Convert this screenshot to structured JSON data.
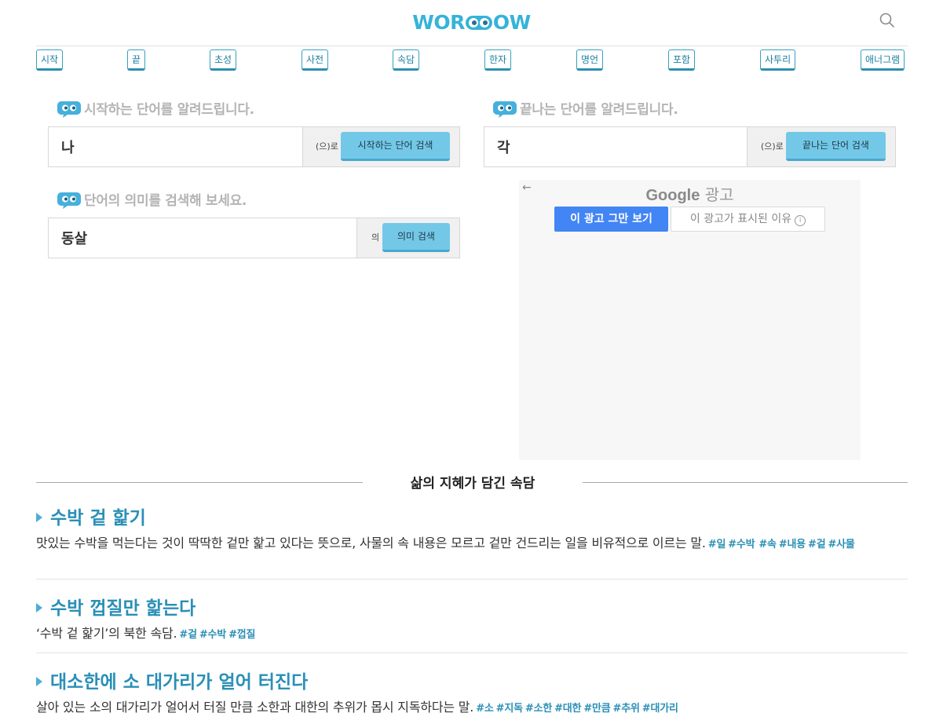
{
  "header": {
    "logo_text_left": "WOR",
    "logo_text_right": "OW",
    "nav": [
      "시작",
      "끝",
      "초성",
      "사전",
      "속담",
      "한자",
      "명언",
      "포함",
      "사투리",
      "애너그램"
    ]
  },
  "start_search": {
    "title": "시작하는 단어를 알려드립니다.",
    "value": "나",
    "suffix": "(으)로",
    "button": "시작하는 단어 검색"
  },
  "end_search": {
    "title": "끝나는 단어를 알려드립니다.",
    "value": "각",
    "suffix": "(으)로",
    "button": "끝나는 단어 검색"
  },
  "meaning_search": {
    "title": "단어의 의미를 검색해 보세요.",
    "value": "동살",
    "suffix": "의",
    "button": "의미 검색"
  },
  "ad": {
    "back": "←",
    "brand": "Google",
    "label": "광고",
    "stop_button": "이 광고 그만 보기",
    "why_button": "이 광고가 표시된 이유",
    "info_glyph": "i"
  },
  "proverbs_section": {
    "title": "삶의 지혜가 담긴 속담",
    "items": [
      {
        "title": "수박 겉 핥기",
        "desc": "맛있는 수박을 먹는다는 것이 딱딱한 겉만 핥고 있다는 뜻으로, 사물의 속 내용은 모르고 겉만 건드리는 일을 비유적으로 이르는 말.",
        "tags": [
          "#일",
          "#수박",
          "#속",
          "#내용",
          "#겉",
          "#사물"
        ]
      },
      {
        "title": "수박 껍질만 핥는다",
        "desc": "‘수박 겉 핥기’의 북한 속담.",
        "tags": [
          "#겉",
          "#수박",
          "#껍질"
        ]
      },
      {
        "title": "대소한에 소 대가리가 얼어 터진다",
        "desc": "살아 있는 소의 대가리가 얼어서 터질 만큼 소한과 대한의 추위가 몹시 지독하다는 말.",
        "tags": [
          "#소",
          "#지독",
          "#소한",
          "#대한",
          "#만큼",
          "#추위",
          "#대가리"
        ]
      }
    ]
  },
  "colors": {
    "accent": "#36b3d9",
    "button": "#73c8e8",
    "link": "#2a8fb6"
  }
}
